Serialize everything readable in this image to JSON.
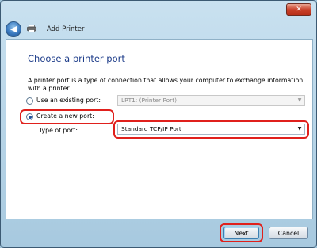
{
  "window": {
    "title": "Add Printer",
    "close_label": "✕"
  },
  "nav": {
    "back_label": "◀"
  },
  "page": {
    "heading": "Choose a printer port",
    "description": "A printer port is a type of connection that allows your computer to exchange information with a printer."
  },
  "options": {
    "existing": {
      "label": "Use an existing port:",
      "selected": false,
      "value": "LPT1: (Printer Port)",
      "enabled": false
    },
    "create": {
      "label": "Create a new port:",
      "selected": true
    },
    "type_of_port": {
      "label": "Type of port:",
      "value": "Standard TCP/IP Port"
    }
  },
  "buttons": {
    "next": "Next",
    "cancel": "Cancel"
  },
  "colors": {
    "heading": "#1e3d8a",
    "highlight": "#e0201c"
  },
  "icons": {
    "back": "back-arrow-icon",
    "printer": "printer-icon",
    "dropdown": "chevron-down-icon"
  }
}
